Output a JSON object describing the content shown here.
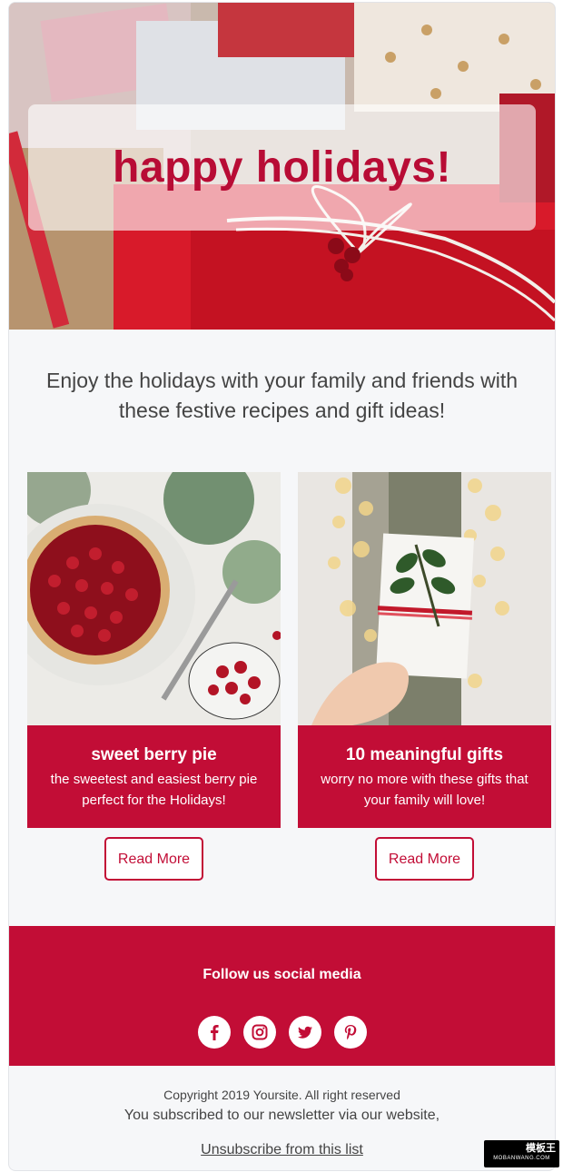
{
  "hero": {
    "title": "happy holidays!"
  },
  "intro": {
    "text": "Enjoy the holidays with your family and friends with these festive recipes and gift ideas!"
  },
  "features": [
    {
      "title": "sweet berry pie",
      "description": "the sweetest and easiest berry pie perfect for the Holidays!",
      "button": "Read More",
      "image": "berry-pie-photo"
    },
    {
      "title": "10 meaningful gifts",
      "description": "worry no more with these gifts that your family will love!",
      "button": "Read More",
      "image": "gift-in-hand-photo"
    }
  ],
  "social": {
    "heading": "Follow us social media",
    "icons": [
      "facebook-icon",
      "instagram-icon",
      "twitter-icon",
      "pinterest-icon"
    ]
  },
  "footer": {
    "copyright": "Copyright 2019 Yoursite. All right reserved",
    "subscribed": "You subscribed to our newsletter via our website,",
    "unsubscribe": "Unsubscribe from this list"
  },
  "watermark": {
    "top": "模板王",
    "bottom": "MOBANWANG.COM"
  },
  "colors": {
    "brand": "#c20d36",
    "background": "#f6f7f9",
    "text": "#444444"
  }
}
